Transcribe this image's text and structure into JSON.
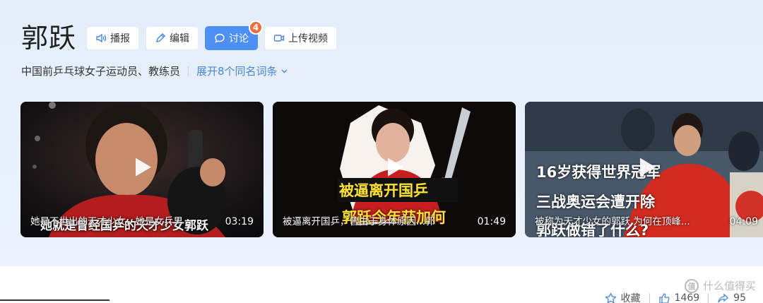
{
  "entry": {
    "title": "郭跃",
    "description": "中国前乒乓球女子运动员、教练员",
    "expand_label": "展开8个同名词条"
  },
  "toolbar": {
    "broadcast_label": "播报",
    "edit_label": "编辑",
    "discuss_label": "讨论",
    "discuss_badge": "4",
    "upload_label": "上传视频"
  },
  "videos": [
    {
      "caption": "她是不世出的天才少女，她是女乒男",
      "overlay": "她就是曾经国乒的天才少女郭跃",
      "duration": "03:19"
    },
    {
      "caption": "被逼离开国乒，曾由于身体原因...郭",
      "overlay_top": "被逼离开国乒",
      "overlay_bottom": "郭跃今年获加何",
      "duration": "01:49"
    },
    {
      "caption": "被称为天才少女的郭跃 为何在顶峰...",
      "overlay_line1": "16岁获得世界冠军",
      "overlay_line2": "三战奥运会遭开除",
      "overlay_line3": "郭跃做错了什么?",
      "duration": "04:09"
    }
  ],
  "actions": {
    "favorite_label": "收藏",
    "like_count": "1469",
    "share_count": "95"
  },
  "watermark": {
    "text": "什么值得买",
    "icon_char": "值"
  },
  "colors": {
    "accent": "#4d8ff3",
    "badge": "#f26b3a",
    "link": "#4a86d6"
  }
}
